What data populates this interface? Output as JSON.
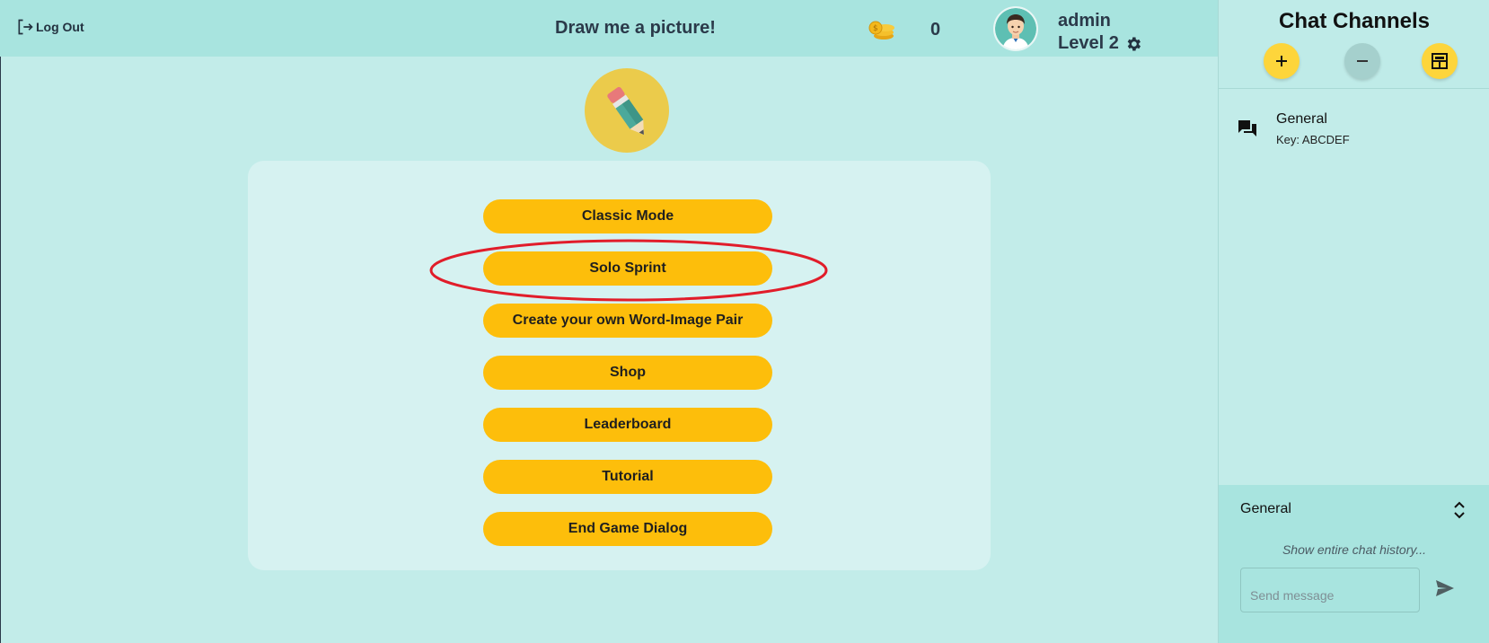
{
  "header": {
    "logout_label": "Log Out",
    "title": "Draw me a picture!",
    "coins": "0",
    "username": "admin",
    "level": "Level 2"
  },
  "menu": {
    "buttons": [
      {
        "label": "Classic Mode"
      },
      {
        "label": "Solo Sprint",
        "highlighted": true
      },
      {
        "label": "Create your own Word-Image Pair"
      },
      {
        "label": "Shop"
      },
      {
        "label": "Leaderboard"
      },
      {
        "label": "Tutorial"
      },
      {
        "label": "End Game Dialog"
      }
    ]
  },
  "chat": {
    "title": "Chat Channels",
    "actions": [
      "add-channel",
      "remove-channel",
      "channel-layout"
    ],
    "channels": [
      {
        "name": "General",
        "key": "Key: ABCDEF"
      }
    ],
    "active": {
      "name": "General",
      "history_link": "Show entire chat history...",
      "input_placeholder": "Send message"
    }
  },
  "colors": {
    "background": "#c2ece9",
    "topbar": "#a8e4df",
    "button": "#fdbe0b",
    "highlight": "#e11d2a"
  },
  "icons": [
    "logout-icon",
    "coins-icon",
    "avatar",
    "gear-icon",
    "pencil-icon",
    "plus-icon",
    "minus-icon",
    "layout-icon",
    "chat-icon",
    "chevron-updown-icon",
    "send-icon"
  ]
}
